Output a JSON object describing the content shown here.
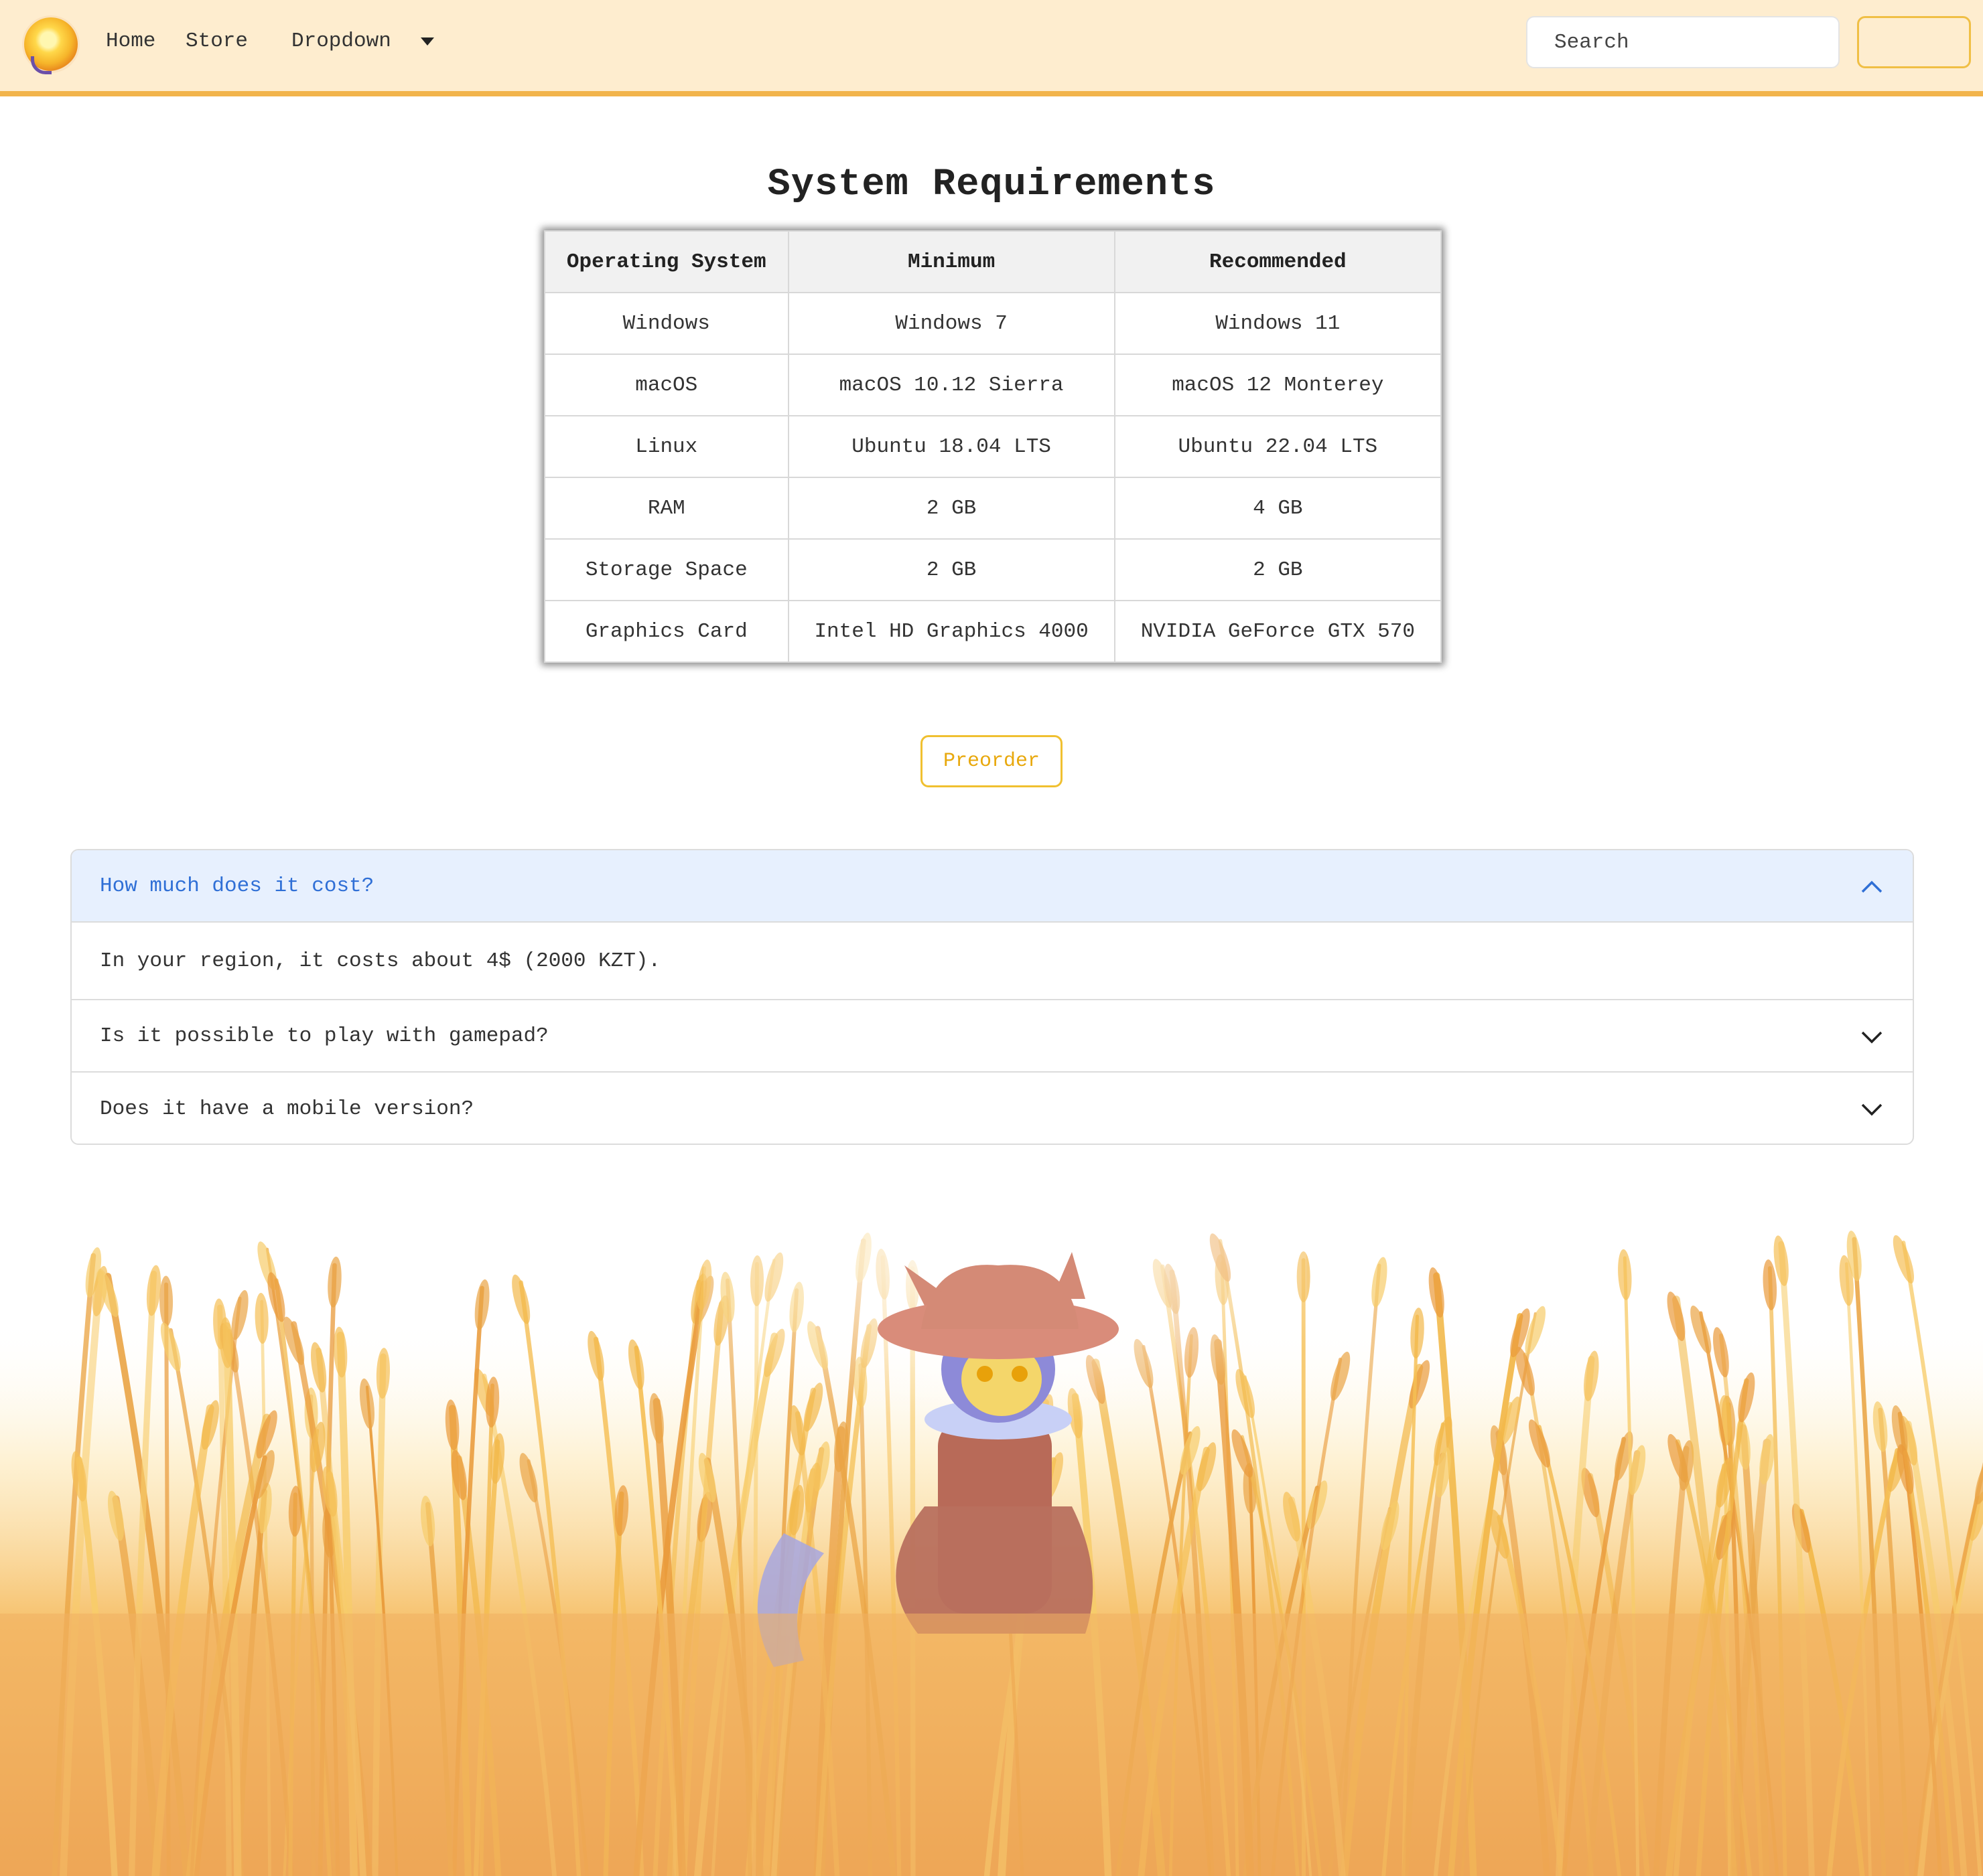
{
  "nav": {
    "links": [
      "Home",
      "Store",
      "Dropdown"
    ],
    "search_placeholder": "Search",
    "accent": "#f2b44b"
  },
  "title": "System Requirements",
  "table": {
    "headers": [
      "Operating System",
      "Minimum",
      "Recommended"
    ],
    "rows": [
      [
        "Windows",
        "Windows 7",
        "Windows 11"
      ],
      [
        "macOS",
        "macOS 10.12 Sierra",
        "macOS 12 Monterey"
      ],
      [
        "Linux",
        "Ubuntu 18.04 LTS",
        "Ubuntu 22.04 LTS"
      ],
      [
        "RAM",
        "2 GB",
        "4 GB"
      ],
      [
        "Storage Space",
        "2 GB",
        "2 GB"
      ],
      [
        "Graphics Card",
        "Intel HD Graphics 4000",
        "NVIDIA GeForce GTX 570"
      ]
    ]
  },
  "preorder_label": "Preorder",
  "faq": [
    {
      "question": "How much does it cost?",
      "answer": "In your region, it costs about 4$ (2000 KZT).",
      "open": true
    },
    {
      "question": "Is it possible to play with gamepad?",
      "open": false
    },
    {
      "question": "Does it have a mobile version?",
      "open": false
    }
  ],
  "colors": {
    "navbar_bg": "#feedcf",
    "preorder": "#f0c030",
    "accordion_active": "#2f6fd6"
  }
}
